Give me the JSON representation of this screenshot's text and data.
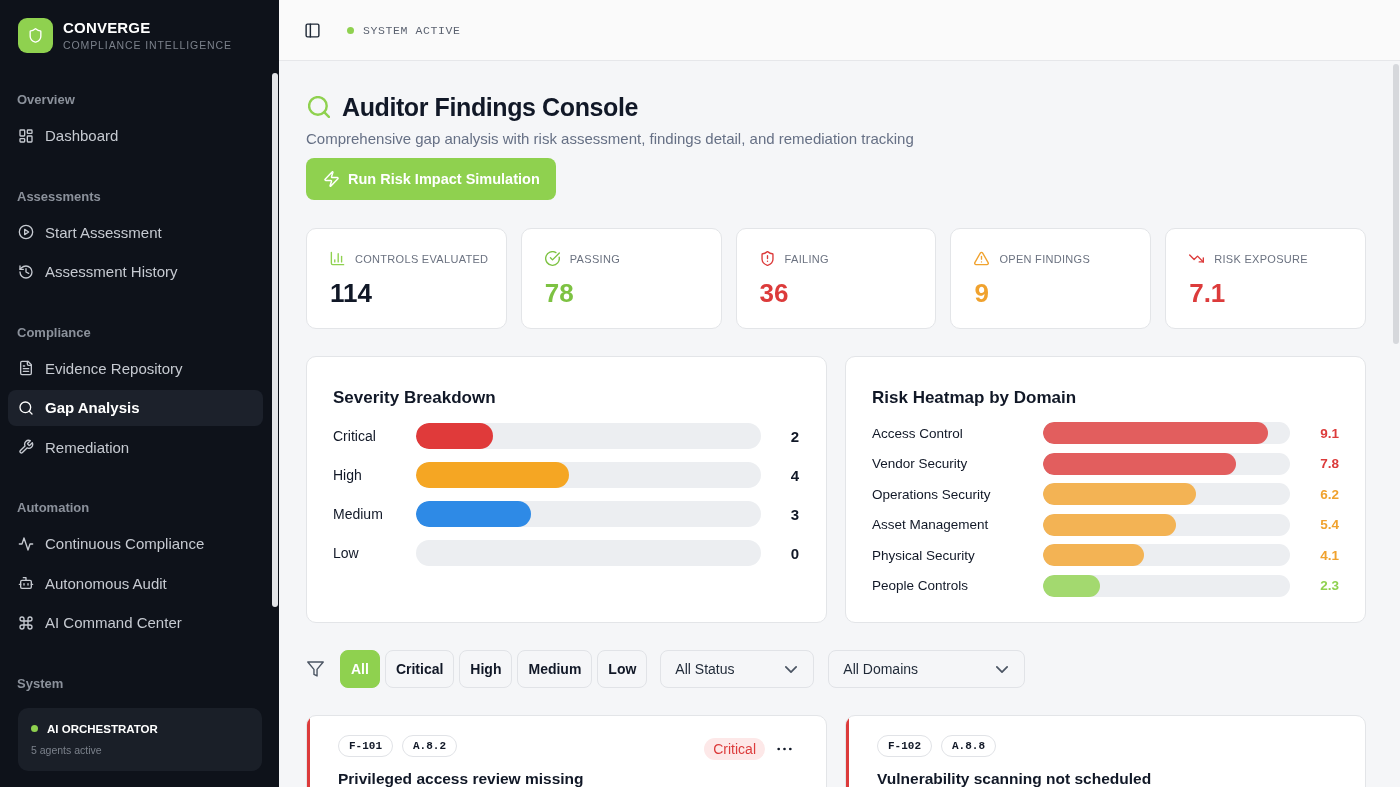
{
  "sidebar": {
    "brand": {
      "name": "CONVERGE",
      "tagline": "COMPLIANCE INTELLIGENCE"
    },
    "sections": [
      {
        "title": "Overview",
        "items": [
          {
            "label": "Dashboard",
            "selected": false
          }
        ]
      },
      {
        "title": "Assessments",
        "items": [
          {
            "label": "Start Assessment",
            "selected": false
          },
          {
            "label": "Assessment History",
            "selected": false
          }
        ]
      },
      {
        "title": "Compliance",
        "items": [
          {
            "label": "Evidence Repository",
            "selected": false
          },
          {
            "label": "Gap Analysis",
            "selected": true
          },
          {
            "label": "Remediation",
            "selected": false
          }
        ]
      },
      {
        "title": "Automation",
        "items": [
          {
            "label": "Continuous Compliance",
            "selected": false
          },
          {
            "label": "Autonomous Audit",
            "selected": false
          },
          {
            "label": "AI Command Center",
            "selected": false
          }
        ]
      }
    ],
    "system": {
      "title": "System",
      "card": {
        "name": "AI ORCHESTRATOR",
        "detail": "5 agents active",
        "active": true
      }
    }
  },
  "header": {
    "status": {
      "label": "SYSTEM ACTIVE",
      "active": true
    }
  },
  "page": {
    "title": "Auditor Findings Console",
    "subtitle": "Comprehensive gap analysis with risk assessment, findings detail, and remediation tracking",
    "action_button": "Run Risk Impact Simulation"
  },
  "stats": [
    {
      "label": "CONTROLS EVALUATED",
      "value": "114",
      "color": "#111827"
    },
    {
      "label": "PASSING",
      "value": "78",
      "color": "#7dc242"
    },
    {
      "label": "FAILING",
      "value": "36",
      "color": "#dc3b3b"
    },
    {
      "label": "OPEN FINDINGS",
      "value": "9",
      "color": "#f0a22e"
    },
    {
      "label": "RISK EXPOSURE",
      "value": "7.1",
      "color": "#dc3b3b"
    }
  ],
  "severity_breakdown": {
    "title": "Severity Breakdown",
    "rows": [
      {
        "label": "Critical",
        "level": 0.222,
        "reading": "2",
        "color": "#e03a3a"
      },
      {
        "label": "High",
        "level": 0.444,
        "reading": "4",
        "color": "#f5a623"
      },
      {
        "label": "Medium",
        "level": 0.333,
        "reading": "3",
        "color": "#2e8ae6"
      },
      {
        "label": "Low",
        "reading": "0"
      }
    ]
  },
  "risk_heatmap": {
    "title": "Risk Heatmap by Domain",
    "rows": [
      {
        "label": "Access Control",
        "level": 0.91,
        "reading": "9.1",
        "color": "#dc3b3b"
      },
      {
        "label": "Vendor Security",
        "level": 0.78,
        "reading": "7.8",
        "color": "#dc3b3b"
      },
      {
        "label": "Operations Security",
        "level": 0.62,
        "reading": "6.2",
        "color": "#f0a22e"
      },
      {
        "label": "Asset Management",
        "level": 0.54,
        "reading": "5.4",
        "color": "#f0a22e"
      },
      {
        "label": "Physical Security",
        "level": 0.41,
        "reading": "4.1",
        "color": "#f0a22e"
      },
      {
        "label": "People Controls",
        "level": 0.23,
        "reading": "2.3",
        "color": "#8fd14f"
      }
    ]
  },
  "filters": {
    "severity_chips": [
      {
        "label": "All",
        "selected": true
      },
      {
        "label": "Critical",
        "selected": false
      },
      {
        "label": "High",
        "selected": false
      },
      {
        "label": "Medium",
        "selected": false
      },
      {
        "label": "Low",
        "selected": false
      }
    ],
    "dropdowns": [
      {
        "value": "All Status"
      },
      {
        "value": "All Domains"
      }
    ]
  },
  "findings": [
    {
      "id": "F-101",
      "control": "A.8.2",
      "severity": "Critical",
      "menu": true,
      "title": "Privileged access review missing",
      "color": "#dc3b3b"
    },
    {
      "id": "F-102",
      "control": "A.8.8",
      "menu": false,
      "title": "Vulnerability scanning not scheduled",
      "color": "#dc3b3b"
    }
  ]
}
